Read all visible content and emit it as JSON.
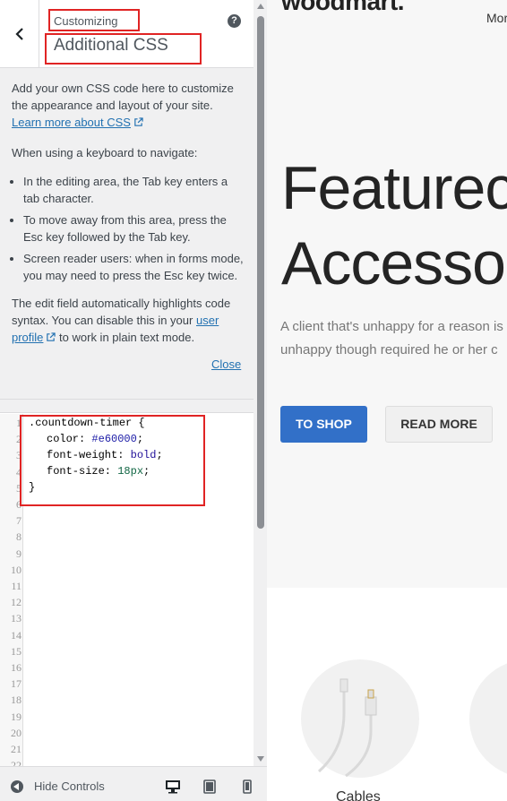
{
  "header": {
    "subtitle": "Customizing",
    "title": "Additional CSS"
  },
  "description": {
    "intro": "Add your own CSS code here to customize the appearance and layout of your site.",
    "learn_link": "Learn more about CSS",
    "keyboard_heading": "When using a keyboard to navigate:",
    "bullets": [
      "In the editing area, the Tab key enters a tab character.",
      "To move away from this area, press the Esc key followed by the Tab key.",
      "Screen reader users: when in forms mode, you may need to press the Esc key twice."
    ],
    "syntax_text_1": "The edit field automatically highlights code syntax. You can disable this in your",
    "user_profile_link": "user profile",
    "syntax_text_2": "to work in plain text mode.",
    "close_link": "Close"
  },
  "editor": {
    "line_numbers": [
      "1",
      "2",
      "3",
      "4",
      "5",
      "6",
      "7",
      "8",
      "9",
      "10",
      "11",
      "12",
      "13",
      "14",
      "15",
      "16",
      "17",
      "18",
      "19",
      "20",
      "21",
      "22"
    ],
    "code": {
      "selector": ".countdown-timer {",
      "color_prop": "color: ",
      "color_val": "#e60000",
      "weight_prop": "font-weight: ",
      "weight_val": "bold",
      "size_prop": "font-size: ",
      "size_val": "18px",
      "close": "}"
    }
  },
  "footer": {
    "hide_controls": "Hide Controls"
  },
  "preview": {
    "logo": "woodmart.",
    "menu_more": "Mor",
    "hero_line1": "Featurec",
    "hero_line2": "Accesso",
    "hero_text_line1": "A client that's unhappy for a reason is",
    "hero_text_line2": "unhappy though required he or her c",
    "btn_shop": "TO SHOP",
    "btn_more": "READ MORE",
    "category_label": "Cables"
  },
  "colors": {
    "link": "#2271b1",
    "highlight_box": "#e02424",
    "primary_button": "#3270c8"
  }
}
